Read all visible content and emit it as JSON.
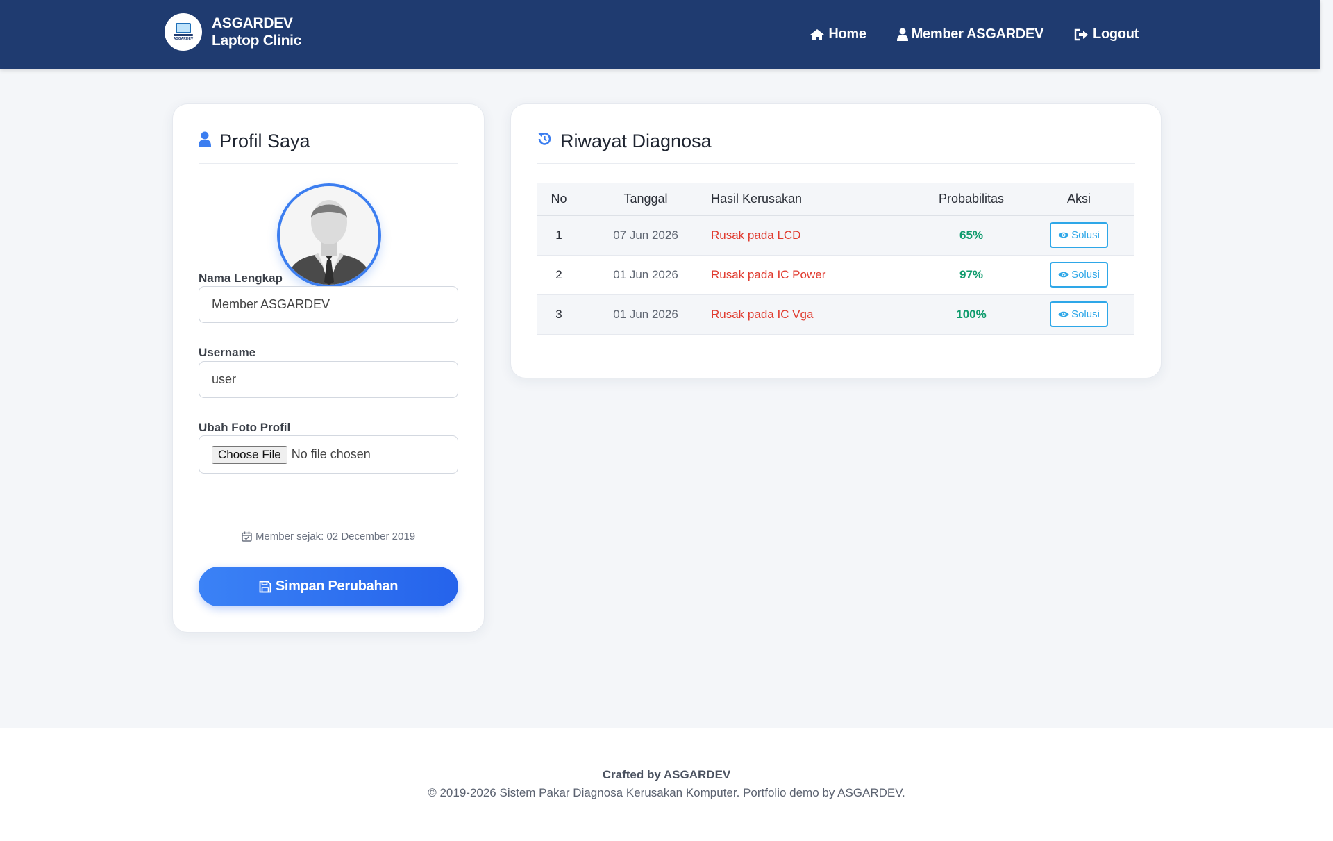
{
  "brand": {
    "line1": "ASGARDEV",
    "line2": "Laptop Clinic",
    "logo_icon": "laptop-icon",
    "logo_text": "ASGARDEV"
  },
  "nav": {
    "home": "Home",
    "member": "Member ASGARDEV",
    "logout": "Logout"
  },
  "profile": {
    "title": "Profil Saya",
    "name_label": "Nama Lengkap",
    "name_value": "Member ASGARDEV",
    "username_label": "Username",
    "username_value": "user",
    "photo_label": "Ubah Foto Profil",
    "file_button": "Choose File",
    "file_status": "No file chosen",
    "member_since": "Member sejak: 02 December 2019",
    "save_label": "Simpan Perubahan"
  },
  "history": {
    "title": "Riwayat Diagnosa",
    "columns": {
      "no": "No",
      "date": "Tanggal",
      "result": "Hasil Kerusakan",
      "prob": "Probabilitas",
      "action": "Aksi"
    },
    "rows": [
      {
        "no": "1",
        "date": "07 Jun 2026",
        "result": "Rusak pada LCD",
        "prob": "65%",
        "action": "Solusi"
      },
      {
        "no": "2",
        "date": "01 Jun 2026",
        "result": "Rusak pada IC Power",
        "prob": "97%",
        "action": "Solusi"
      },
      {
        "no": "3",
        "date": "01 Jun 2026",
        "result": "Rusak pada IC Vga",
        "prob": "100%",
        "action": "Solusi"
      }
    ]
  },
  "footer": {
    "crafted": "Crafted by ASGARDEV",
    "copyright": "© 2019-2026 Sistem Pakar Diagnosa Kerusakan Komputer. Portfolio demo by ASGARDEV."
  },
  "colors": {
    "navbar": "#1f3b70",
    "accent": "#3c7ef0",
    "danger": "#e03a2e",
    "success": "#0d9b6c",
    "info": "#2ea7e8"
  }
}
